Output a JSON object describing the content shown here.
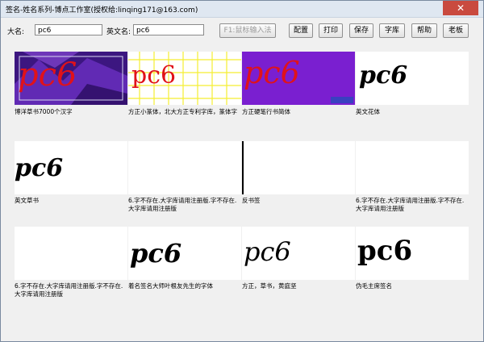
{
  "window": {
    "title": "签名-姓名系列-博点工作室(授权给:linqing171@163.com)",
    "close_glyph": "✕"
  },
  "form": {
    "cn_label": "大名:",
    "cn_value": "pc6",
    "en_label": "英文名:",
    "en_value": "pc6"
  },
  "toolbar": {
    "ime_button": "F1:鼠标输入法",
    "buttons": [
      "配置",
      "打印",
      "保存",
      "字库",
      "帮助",
      "老板"
    ]
  },
  "tiles": [
    {
      "text": "pc6",
      "caption": "博洋草书7000个汉字"
    },
    {
      "text": "pc6",
      "caption": "方正小篆体，北大方正专利字库，篆体字"
    },
    {
      "text": "pc6",
      "caption": "方正硬笔行书简体"
    },
    {
      "text": "pc6",
      "caption": "英文花体"
    },
    {
      "text": "pc6",
      "caption": "英文草书"
    },
    {
      "text": "",
      "caption": "6.字不存在.大字库请用注册版.字不存在.大字库请用注册版"
    },
    {
      "text": "",
      "caption": "反书签"
    },
    {
      "text": "",
      "caption": "6.字不存在.大字库请用注册版.字不存在.大字库请用注册版"
    },
    {
      "text": "",
      "caption": "6.字不存在.大字库请用注册版.字不存在.大字库请用注册版"
    },
    {
      "text": "pc6",
      "caption": "着名签名大师叶根友先生的字体"
    },
    {
      "text": "pc6",
      "caption": "方正，草书，黄庭坚"
    },
    {
      "text": "pc6",
      "caption": "伪毛主席签名"
    }
  ],
  "colors": {
    "red_ink": "#e0121a",
    "purple_bg": "#5a1fa0",
    "violet_bg": "#7a1fd0",
    "grid_yellow": "#f5ee30"
  }
}
